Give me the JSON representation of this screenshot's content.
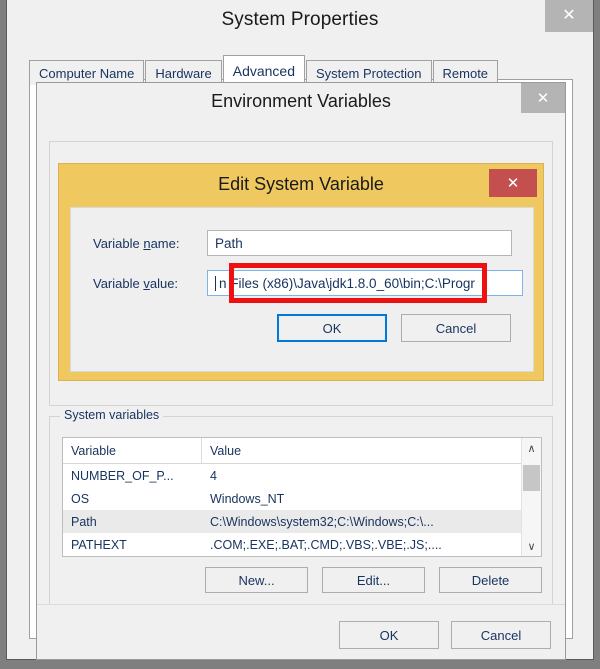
{
  "window": {
    "title": "System Properties",
    "close_label": "✕"
  },
  "tabs": [
    {
      "label": "Computer Name",
      "active": false
    },
    {
      "label": "Hardware",
      "active": false
    },
    {
      "label": "Advanced",
      "active": true
    },
    {
      "label": "System Protection",
      "active": false
    },
    {
      "label": "Remote",
      "active": false
    }
  ],
  "env_dialog": {
    "title": "Environment Variables",
    "close_label": "✕",
    "user_group_legend": "",
    "system_group_legend": "System variables",
    "table": {
      "headers": [
        "Variable",
        "Value"
      ],
      "rows": [
        {
          "variable": "NUMBER_OF_P...",
          "value": "4",
          "selected": false
        },
        {
          "variable": "OS",
          "value": "Windows_NT",
          "selected": false
        },
        {
          "variable": "Path",
          "value": "C:\\Windows\\system32;C:\\Windows;C:\\...",
          "selected": true
        },
        {
          "variable": "PATHEXT",
          "value": ".COM;.EXE;.BAT;.CMD;.VBS;.VBE;.JS;....",
          "selected": false
        }
      ],
      "scroll_up_icon": "∧",
      "scroll_down_icon": "∨"
    },
    "row_buttons": [
      "New...",
      "Edit...",
      "Delete"
    ],
    "footer_buttons": [
      "OK",
      "Cancel"
    ]
  },
  "edit_dialog": {
    "title": "Edit System Variable",
    "close_label": "✕",
    "name_label_pre": "Variable ",
    "name_label_accel": "n",
    "name_label_post": "ame:",
    "value_label_pre": "Variable ",
    "value_label_accel": "v",
    "value_label_post": "alue:",
    "variable_name": "Path",
    "variable_value": "n Files (x86)\\Java\\jdk1.8.0_60\\bin;C:\\Progr",
    "ok_label": "OK",
    "cancel_label": "Cancel"
  },
  "colors": {
    "dialog_accent": "#F0C860",
    "close_red": "#C44F4F",
    "close_gray": "#B4B4B4",
    "focus_blue": "#0078D7",
    "annotation_red": "#EE1111",
    "selection_gray": "#EAEAEA",
    "text_navy": "#17335E"
  }
}
